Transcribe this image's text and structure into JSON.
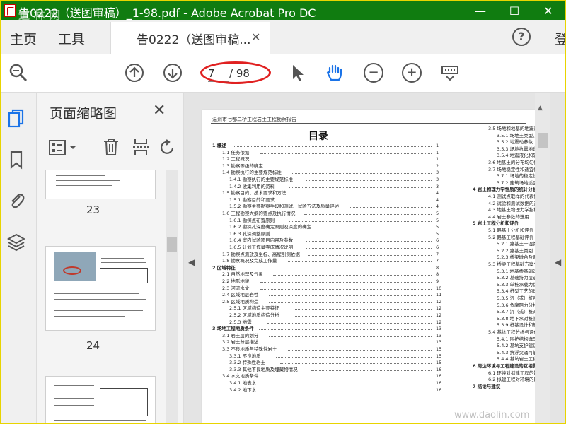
{
  "titlebar": {
    "title": "告0222（送图审稿）_1-98.pdf - Adobe Acrobat Pro DC",
    "minimize": "—",
    "maximize": "☐",
    "close": "✕"
  },
  "menubar": {
    "home": "主页",
    "tools": "工具",
    "tab_label": "告0222（送图审稿...",
    "tab_close": "✕",
    "help": "?",
    "signin": "登"
  },
  "toolbar": {
    "current_page": "7",
    "total_pages": "/ 98",
    "zoom_out": "−",
    "zoom_in": "+"
  },
  "thumbpane": {
    "title": "页面缩略图",
    "close": "✕",
    "thumbs": [
      {
        "page": "23"
      },
      {
        "page": "24"
      },
      {
        "page": ""
      }
    ]
  },
  "document": {
    "header": "温州市七都二桥工程岩土工程勘察报告",
    "toc_title": "目录",
    "left_col": [
      {
        "text": "1 概述",
        "page": "1",
        "bold": true
      },
      {
        "text": "1.1 任务依据",
        "page": "1"
      },
      {
        "text": "1.2 工程概况",
        "page": "1"
      },
      {
        "text": "1.3 勘察等级的确定",
        "page": "2"
      },
      {
        "text": "1.4 勘察执行的主要规范标准",
        "page": "3"
      },
      {
        "text": "1.4.1 勘察执行的主要规范标准",
        "page": "3"
      },
      {
        "text": "1.4.2 收集利用的资料",
        "page": "3"
      },
      {
        "text": "1.5 勘察目的、技术要求和方法",
        "page": "4"
      },
      {
        "text": "1.5.1 勘察目的和要求",
        "page": "4"
      },
      {
        "text": "1.5.2 勘察主要勘察手段和测试、试验方法及质量评述",
        "page": "4"
      },
      {
        "text": "1.6 工程勘察大纲的要点及执行情况",
        "page": "5"
      },
      {
        "text": "1.6.1 勘探点布置原则",
        "page": "5"
      },
      {
        "text": "1.6.2 勘探孔深度确定原则及深度的确定",
        "page": "5"
      },
      {
        "text": "1.6.3 孔深调整原则",
        "page": "5"
      },
      {
        "text": "1.6.4 室内试验项目内容及参数",
        "page": "6"
      },
      {
        "text": "1.6.5 计划工作量完成情况说明",
        "page": "6"
      },
      {
        "text": "1.7 勘察点测放及坐标、高程引测依据",
        "page": "7"
      },
      {
        "text": "1.8 勘察概况及完成工作量",
        "page": "7"
      },
      {
        "text": "2 区域特征",
        "page": "8",
        "bold": true
      },
      {
        "text": "2.1 自然地理及气象",
        "page": "8"
      },
      {
        "text": "2.2 地形地貌",
        "page": "9"
      },
      {
        "text": "2.3 河流水文",
        "page": "10"
      },
      {
        "text": "2.4 区域地层岩性",
        "page": "11"
      },
      {
        "text": "2.5 区域地质构造",
        "page": "12"
      },
      {
        "text": "2.5.1 区域构造主要特征",
        "page": "12"
      },
      {
        "text": "2.5.2 区域地质构造分析",
        "page": "12"
      },
      {
        "text": "2.5.3 地震",
        "page": "12"
      },
      {
        "text": "3 场地工程地质条件",
        "page": "13",
        "bold": true
      },
      {
        "text": "3.1 岩土层的划分",
        "page": "13"
      },
      {
        "text": "3.2 岩土分层描述",
        "page": "13"
      },
      {
        "text": "3.3 不良地质与特殊性岩土",
        "page": "15"
      },
      {
        "text": "3.3.1 不良地质",
        "page": "15"
      },
      {
        "text": "3.3.2 特殊性岩土",
        "page": "15"
      },
      {
        "text": "3.3.3 其他不良地质及埋藏物情况",
        "page": "16"
      },
      {
        "text": "3.4 水文地质条件",
        "page": "16"
      },
      {
        "text": "3.4.1 地表水",
        "page": "16"
      },
      {
        "text": "3.4.2 地下水",
        "page": "16"
      }
    ],
    "right_col": [
      {
        "text": "3.5 场地和地基的地震效应"
      },
      {
        "text": "3.5.1 场地土类型、场地类别"
      },
      {
        "text": "3.5.2 地震动参数"
      },
      {
        "text": "3.5.3 场地抗震地段类别"
      },
      {
        "text": "3.5.4 地震液化和软土震陷"
      },
      {
        "text": "3.6 地基土的分布均匀性与均匀"
      },
      {
        "text": "3.7 场地稳定性和适宜性评价"
      },
      {
        "text": "3.7.1 场地的稳定性"
      },
      {
        "text": "3.7.2 建筑场地适宜性评价"
      },
      {
        "text": "4 岩土物理力学性质的统计分析与选用",
        "bold": true
      },
      {
        "text": "4.1 测试点取样的代表性"
      },
      {
        "text": "4.2 试验和测试数据的正确性、"
      },
      {
        "text": "4.3 地基土物理力学指标的统计"
      },
      {
        "text": "4.4 岩土参数的选用"
      },
      {
        "text": "5 岩土工程分析和评价",
        "bold": true
      },
      {
        "text": "5.1 路基土分析和评价"
      },
      {
        "text": "5.2 路基工程基础评价"
      },
      {
        "text": "5.2.1 路基土干湿类型"
      },
      {
        "text": "5.2.2 路基土类别"
      },
      {
        "text": "5.2.3 桥梁墩台及路基"
      },
      {
        "text": "5.3 桥梁工程基础方案分析"
      },
      {
        "text": "5.3.1 地基桥基础选型分析"
      },
      {
        "text": "5.3.2 基础持力层选择"
      },
      {
        "text": "5.3.3 单桩承载力估算"
      },
      {
        "text": "5.3.4 桩型工艺的选择"
      },
      {
        "text": "5.3.5 沉（或）桩可行性分析"
      },
      {
        "text": "5.3.6 负摩阻力分析"
      },
      {
        "text": "5.3.7 沉（或）桩对周边环境"
      },
      {
        "text": "5.3.8 地下水对桩基设计和施"
      },
      {
        "text": "5.3.9 桩基设计和施工措施"
      },
      {
        "text": "5.4 基坑工程分析与评价"
      },
      {
        "text": "5.4.1 围护结构选型"
      },
      {
        "text": "5.4.2 基坑支护建议"
      },
      {
        "text": "5.4.3 抗浮突涌可能性分析"
      },
      {
        "text": "5.4.4 基坑岩土工程问题分析"
      },
      {
        "text": "6 周边环境与工程建设的互相影响分析",
        "bold": true
      },
      {
        "text": "6.1 环境对拟建工程的影响"
      },
      {
        "text": "6.2 拟建工程对环境的影响"
      },
      {
        "text": "7 结论与建议",
        "bold": true
      }
    ]
  }
}
